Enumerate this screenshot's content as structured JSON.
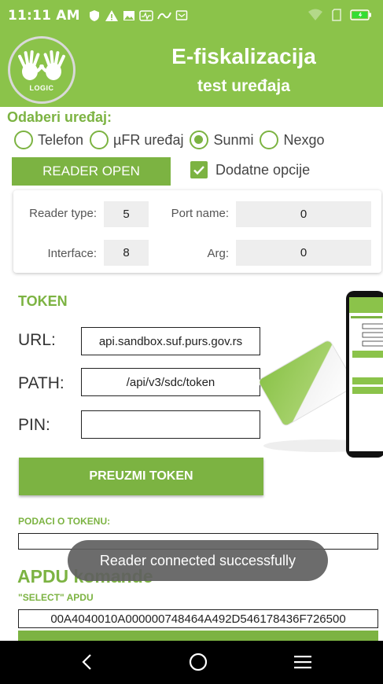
{
  "status_bar": {
    "time": "11:11 AM"
  },
  "header": {
    "logo_text": "LOGIC",
    "title": "E-fiskalizacija",
    "subtitle": "test uređaja"
  },
  "device_select": {
    "label": "Odaberi uređaj:",
    "options": [
      "Telefon",
      "µFR uređaj",
      "Sunmi",
      "Nexgo"
    ],
    "selected": "Sunmi"
  },
  "reader_open_button": "READER OPEN",
  "extra_options": {
    "label": "Dodatne opcije",
    "checked": true
  },
  "reader_card": {
    "reader_type_label": "Reader type:",
    "reader_type_value": "5",
    "port_name_label": "Port name:",
    "port_name_value": "0",
    "interface_label": "Interface:",
    "interface_value": "8",
    "arg_label": "Arg:",
    "arg_value": "0"
  },
  "token": {
    "title": "TOKEN",
    "url_label": "URL:",
    "url_value": "api.sandbox.suf.purs.gov.rs",
    "path_label": "PATH:",
    "path_value": "/api/v3/sdc/token",
    "pin_label": "PIN:",
    "pin_value": "",
    "button": "PREUZMI TOKEN"
  },
  "token_data": {
    "label": "PODACI O TOKENU:",
    "value": ""
  },
  "apdu": {
    "title": "APDU komande",
    "select_label": "\"SELECT\" APDU",
    "select_value": "00A4040010A000000748464A492D546178436F726500"
  },
  "toast": "Reader connected successfully",
  "colors": {
    "brand_green": "#8bc34a",
    "button_green": "#7cb342"
  },
  "icons": [
    "shield-icon",
    "warning-icon",
    "image-icon",
    "signal-icon",
    "wifi-icon",
    "battery-icon",
    "back-icon",
    "home-icon",
    "menu-icon"
  ]
}
